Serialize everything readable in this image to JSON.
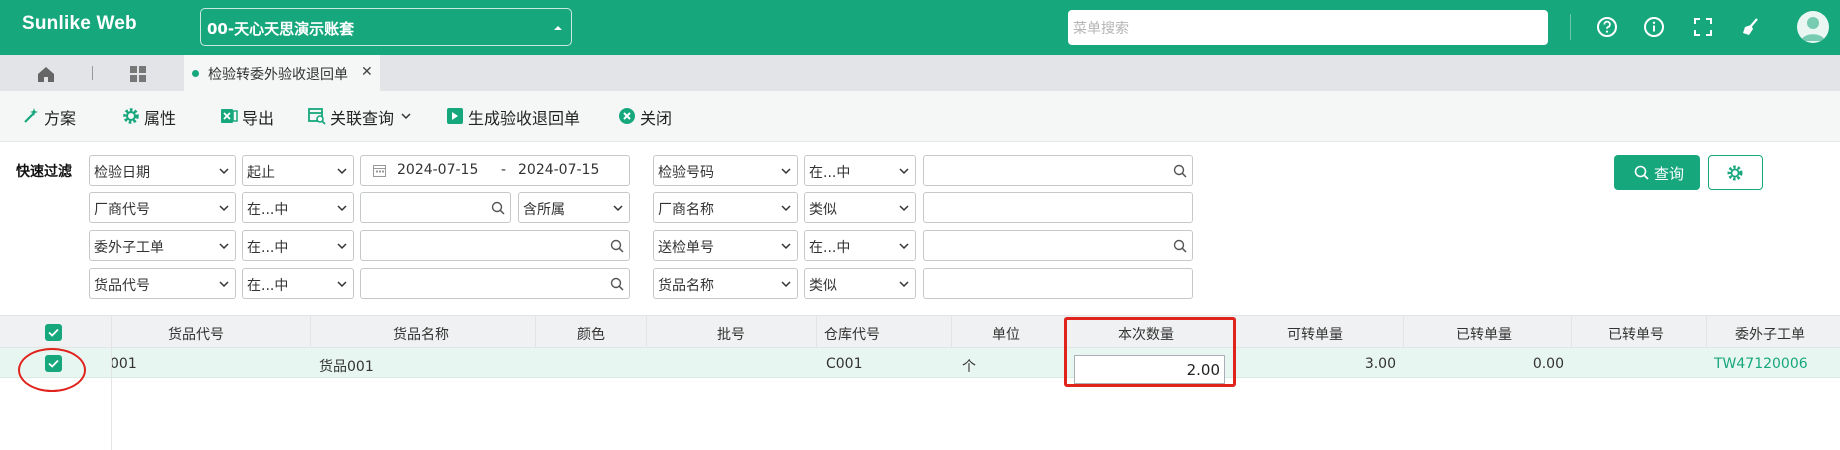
{
  "app": {
    "title": "Sunlike Web",
    "account": "00-天心天思演示账套",
    "search_placeholder": "菜单搜索"
  },
  "tabs": [
    {
      "label": "检验转委外验收退回单",
      "close": "✕"
    }
  ],
  "toolbar": [
    {
      "label": "方案",
      "icon": "wand-icon"
    },
    {
      "label": "属性",
      "icon": "gear-icon"
    },
    {
      "label": "导出",
      "icon": "excel-icon"
    },
    {
      "label": "关联查询",
      "icon": "link-query-icon"
    },
    {
      "label": "生成验收退回单",
      "icon": "generate-icon"
    },
    {
      "label": "关闭",
      "icon": "close-circle-icon"
    }
  ],
  "filter": {
    "label": "快速过滤",
    "row1": {
      "field": "检验日期",
      "op": "起止",
      "date_from": "2024-07-15",
      "date_sep": "-",
      "date_to": "2024-07-15",
      "field2": "检验号码",
      "op2": "在...中"
    },
    "row2": {
      "field": "厂商代号",
      "op": "在...中",
      "extra": "含所属",
      "field2": "厂商名称",
      "op2": "类似"
    },
    "row3": {
      "field": "委外子工单",
      "op": "在...中",
      "field2": "送检单号",
      "op2": "在...中"
    },
    "row4": {
      "field": "货品代号",
      "op": "在...中",
      "field2": "货品名称",
      "op2": "类似"
    },
    "query_button": "查询"
  },
  "table": {
    "columns": [
      "货品代号",
      "货品名称",
      "颜色",
      "批号",
      "仓库代号",
      "单位",
      "本次数量",
      "可转单量",
      "已转单量",
      "已转单号",
      "委外子工单"
    ],
    "rows": [
      {
        "item_code": "001",
        "item_name": "货品001",
        "color": "",
        "batch": "",
        "warehouse": "C001",
        "unit": "个",
        "qty": "2.00",
        "avail_qty": "3.00",
        "converted_qty": "0.00",
        "converted_no": "",
        "sub_order": "TW47120006"
      }
    ]
  },
  "colors": {
    "accent": "#17a77c",
    "highlight": "#e0231c"
  }
}
